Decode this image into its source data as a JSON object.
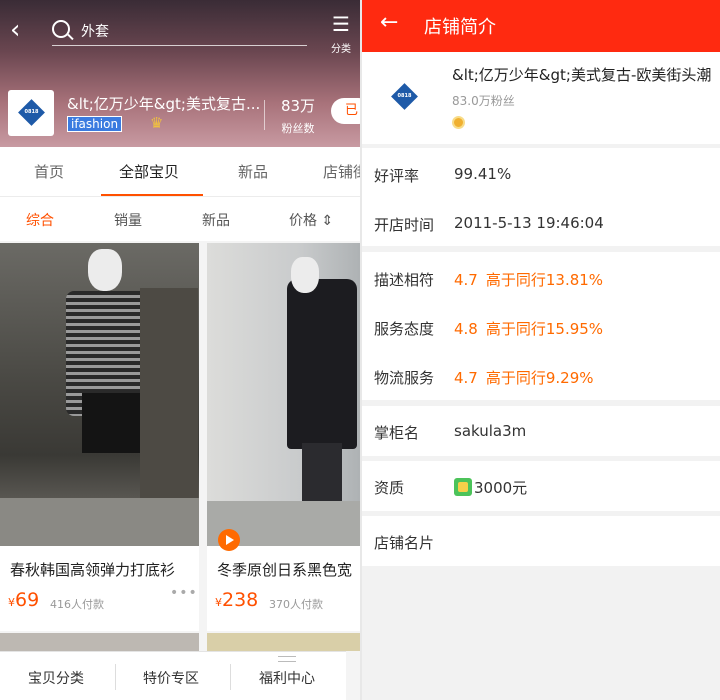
{
  "left": {
    "search_text": "外套",
    "category_label": "分类",
    "shop_name": "&lt;亿万少年&gt;美式复古...",
    "shop_tag": "ifashion",
    "fans_count": "83万",
    "fans_label": "粉丝数",
    "follow_label": "已",
    "logo_text": "0818",
    "tabs": [
      "首页",
      "全部宝贝",
      "新品",
      "店铺街"
    ],
    "sorts": [
      "综合",
      "销量",
      "新品",
      "价格 ⇕"
    ],
    "products": [
      {
        "title": "春秋韩国高领弹力打底衫",
        "price": "69",
        "currency": "¥",
        "paid": "416人付款"
      },
      {
        "title": "冬季原创日系黑色宽",
        "price": "238",
        "currency": "¥",
        "paid": "370人付款"
      }
    ],
    "bottom_bar": [
      "宝贝分类",
      "特价专区",
      "福利中心"
    ]
  },
  "right": {
    "title": "店铺简介",
    "shop_name": "&lt;亿万少年&gt;美式复古-欧美街头潮",
    "fans": "83.0万粉丝",
    "rows": {
      "rating_label": "好评率",
      "rating_value": "99.41%",
      "open_label": "开店时间",
      "open_value": "2011-5-13 19:46:04",
      "desc_label": "描述相符",
      "desc_score": "4.7",
      "desc_cmp": "高于同行13.81%",
      "service_label": "服务态度",
      "service_score": "4.8",
      "service_cmp": "高于同行15.95%",
      "logistics_label": "物流服务",
      "logistics_score": "4.7",
      "logistics_cmp": "高于同行9.29%",
      "owner_label": "掌柜名",
      "owner_value": "sakula3m",
      "deposit_label": "资质",
      "deposit_value": "3000元",
      "card_label": "店铺名片"
    }
  },
  "colors": {
    "accent": "#ff5000",
    "header_red": "#ff2a10",
    "score_orange": "#ff6a00"
  }
}
